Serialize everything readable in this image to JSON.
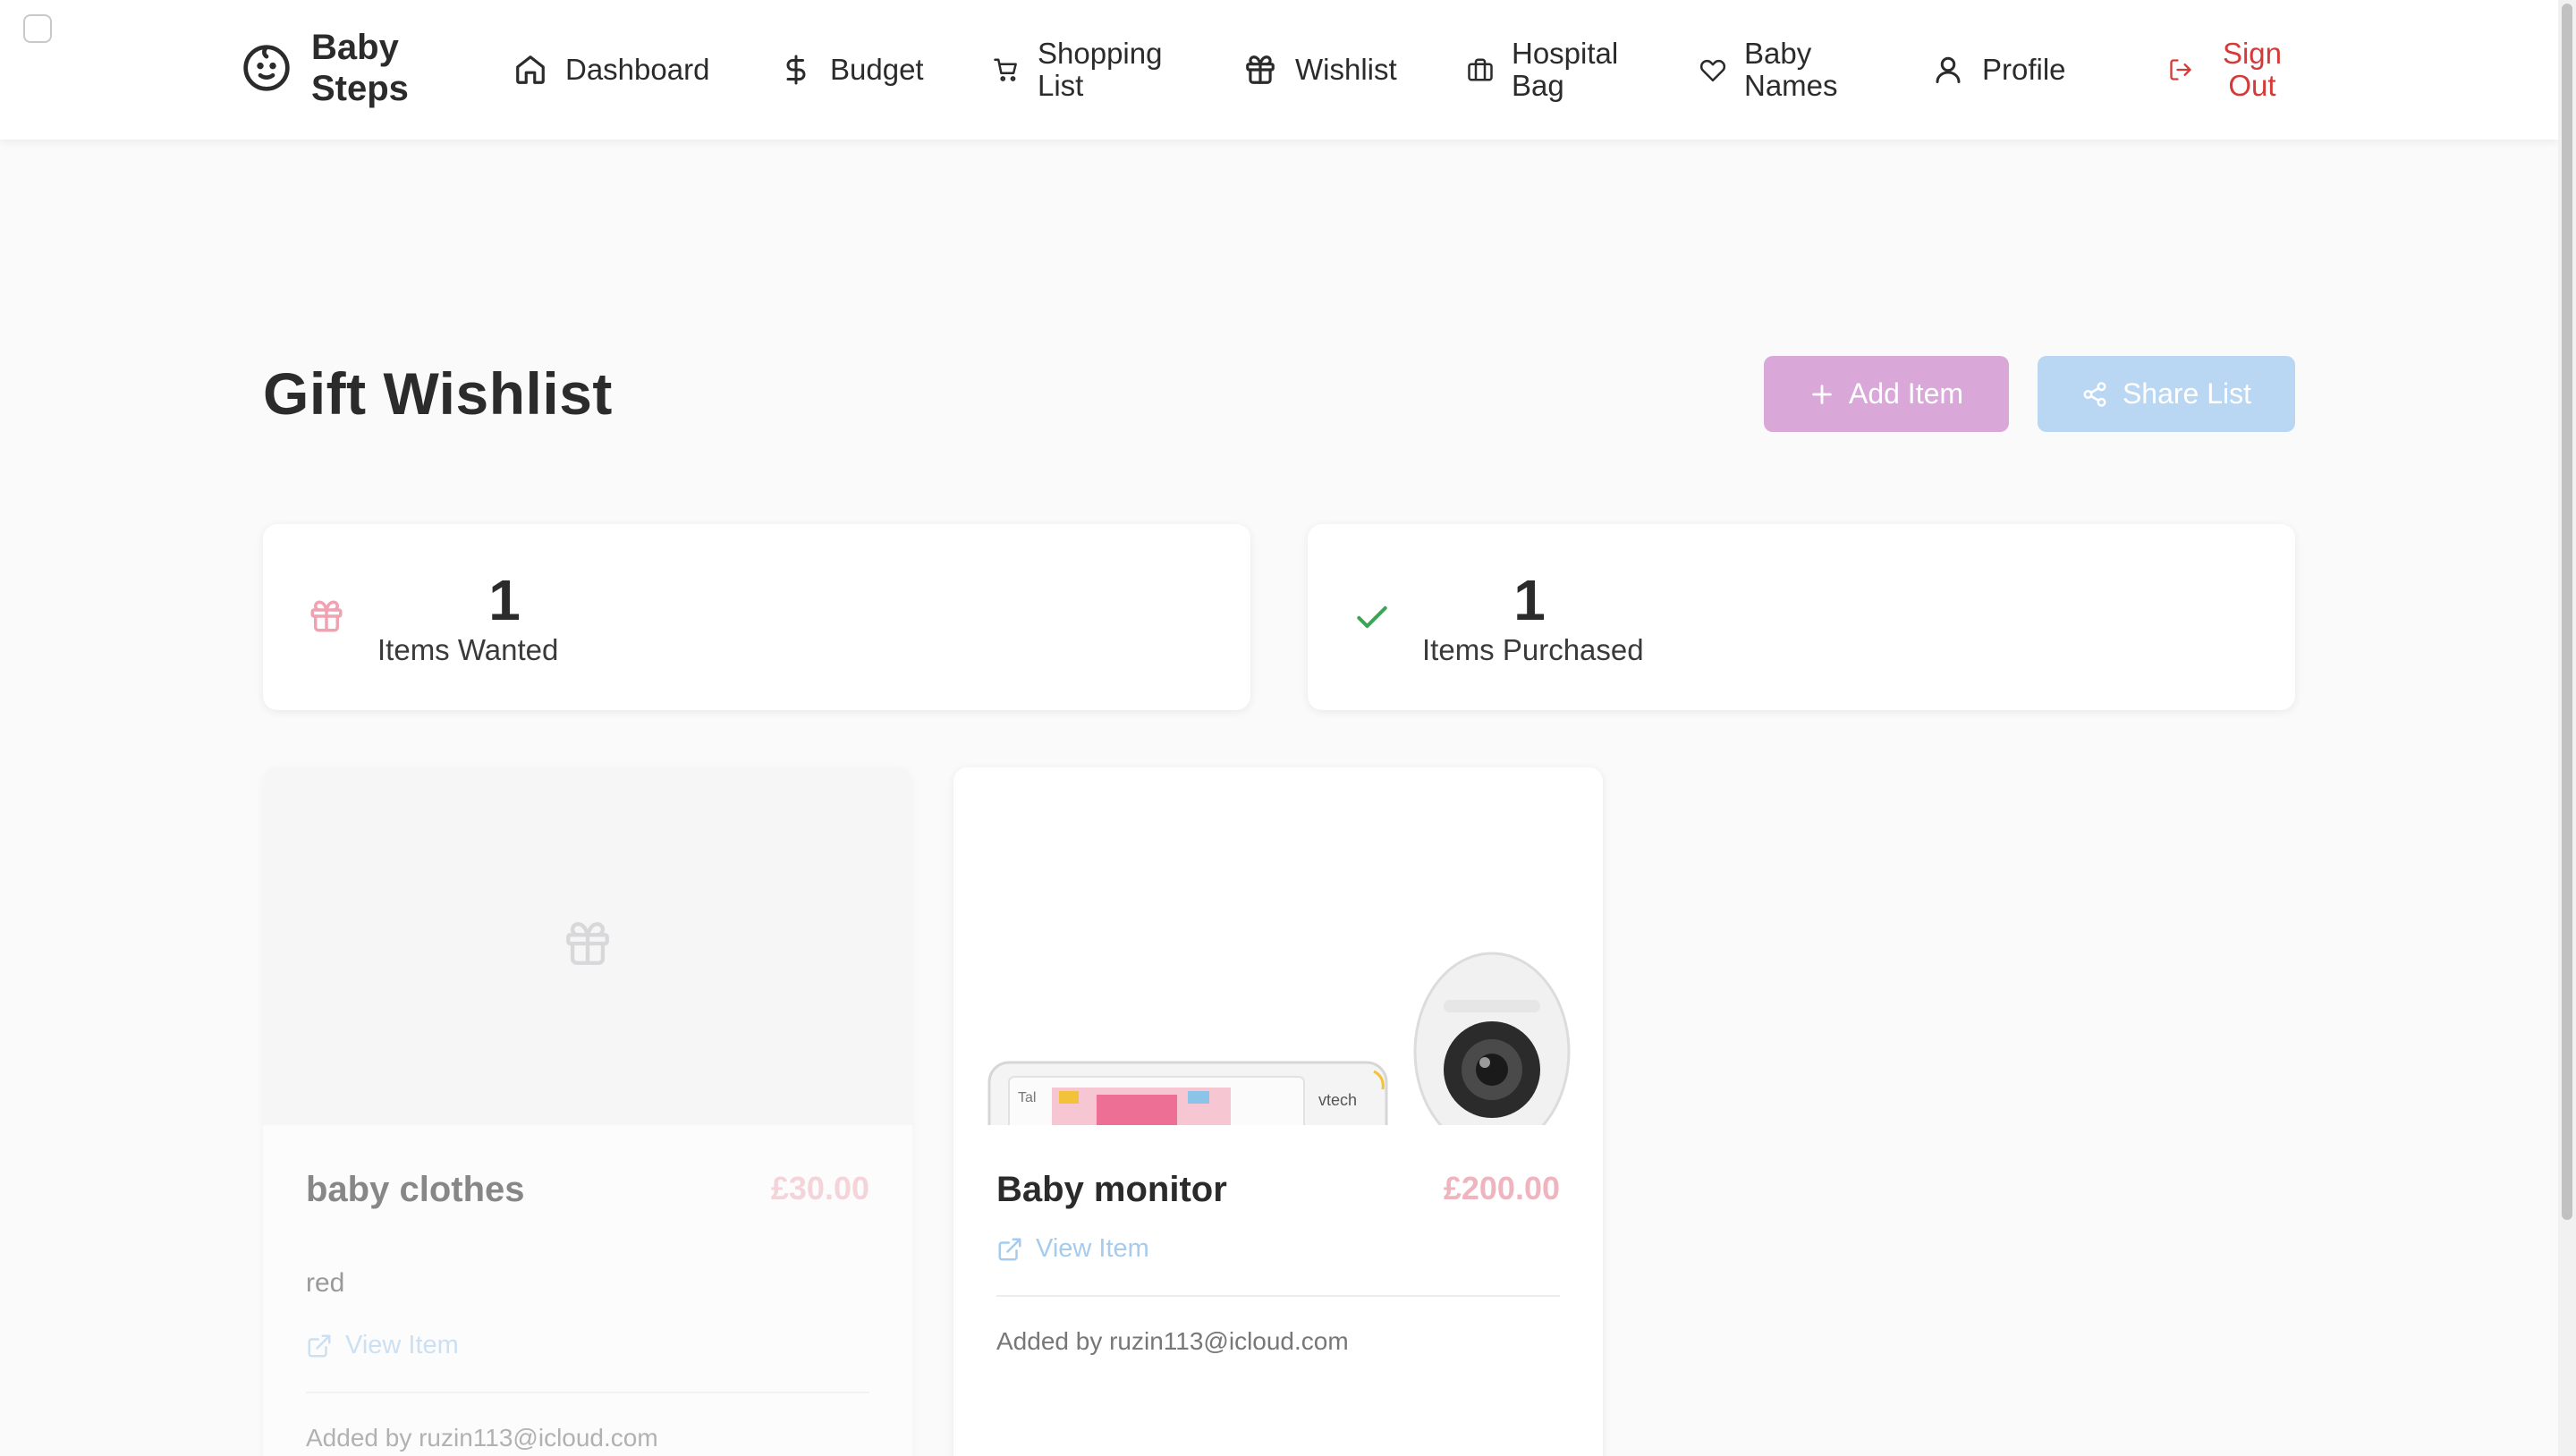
{
  "brand": {
    "title": "Baby Steps",
    "icon": "baby-face-icon"
  },
  "nav": [
    {
      "label": "Dashboard",
      "icon": "home-icon"
    },
    {
      "label": "Budget",
      "icon": "dollar-icon"
    },
    {
      "label": "Shopping List",
      "icon": "cart-icon"
    },
    {
      "label": "Wishlist",
      "icon": "gift-icon"
    },
    {
      "label": "Hospital Bag",
      "icon": "bag-icon"
    },
    {
      "label": "Baby Names",
      "icon": "heart-icon"
    },
    {
      "label": "Profile",
      "icon": "user-icon"
    },
    {
      "label": "Sign Out",
      "icon": "sign-out-icon"
    }
  ],
  "page": {
    "title": "Gift Wishlist"
  },
  "actions": {
    "add_label": "Add Item",
    "share_label": "Share List"
  },
  "stats": {
    "wanted": {
      "value": "1",
      "label": "Items Wanted"
    },
    "purchased": {
      "value": "1",
      "label": "Items Purchased"
    }
  },
  "items": [
    {
      "name": "baby clothes",
      "price": "£30.00",
      "description": "red",
      "link_label": "View Item",
      "added_by": "Added by ruzin113@icloud.com",
      "purchased": true
    },
    {
      "name": "Baby monitor",
      "price": "£200.00",
      "description": "",
      "link_label": "View Item",
      "added_by": "Added by ruzin113@icloud.com",
      "purchased": false,
      "monitor_brand": "vtech",
      "monitor_screen_text": "Tal"
    }
  ],
  "colors": {
    "accent_pink": "#d9a8d9",
    "accent_blue": "#b9d7f3",
    "price_pink": "#f0b4bf",
    "signout_red": "#d43a3a",
    "check_green": "#3aa655"
  }
}
